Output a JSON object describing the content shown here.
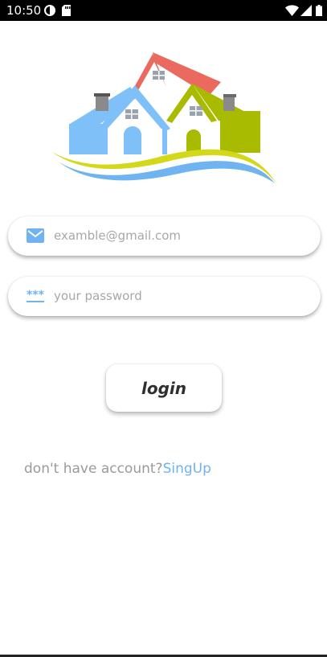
{
  "status_bar": {
    "time": "10:50",
    "left_icons": [
      "data-saver-icon",
      "sd-card-icon"
    ],
    "right_icons": [
      "wifi-icon",
      "cellular-signal-icon",
      "battery-icon"
    ]
  },
  "logo": {
    "icon": "houses-logo-icon",
    "colors": {
      "red_roof": "#ea6a5f",
      "blue_house": "#7ec0f7",
      "green_house": "#a9bb00",
      "yellow_wave": "#d4d81a",
      "blue_wave": "#6fb3f0"
    }
  },
  "form": {
    "email": {
      "icon": "mail-icon",
      "placeholder": "examble@gmail.com",
      "value": ""
    },
    "password": {
      "icon": "password-dots-icon",
      "placeholder": "your password",
      "value": ""
    },
    "login_label": "login"
  },
  "signup": {
    "prompt": "don't have account?",
    "link": "SingUp"
  },
  "colors": {
    "accent": "#6fb3f0",
    "placeholder": "#a8a8a8",
    "prompt_text": "#9a9a9a"
  }
}
